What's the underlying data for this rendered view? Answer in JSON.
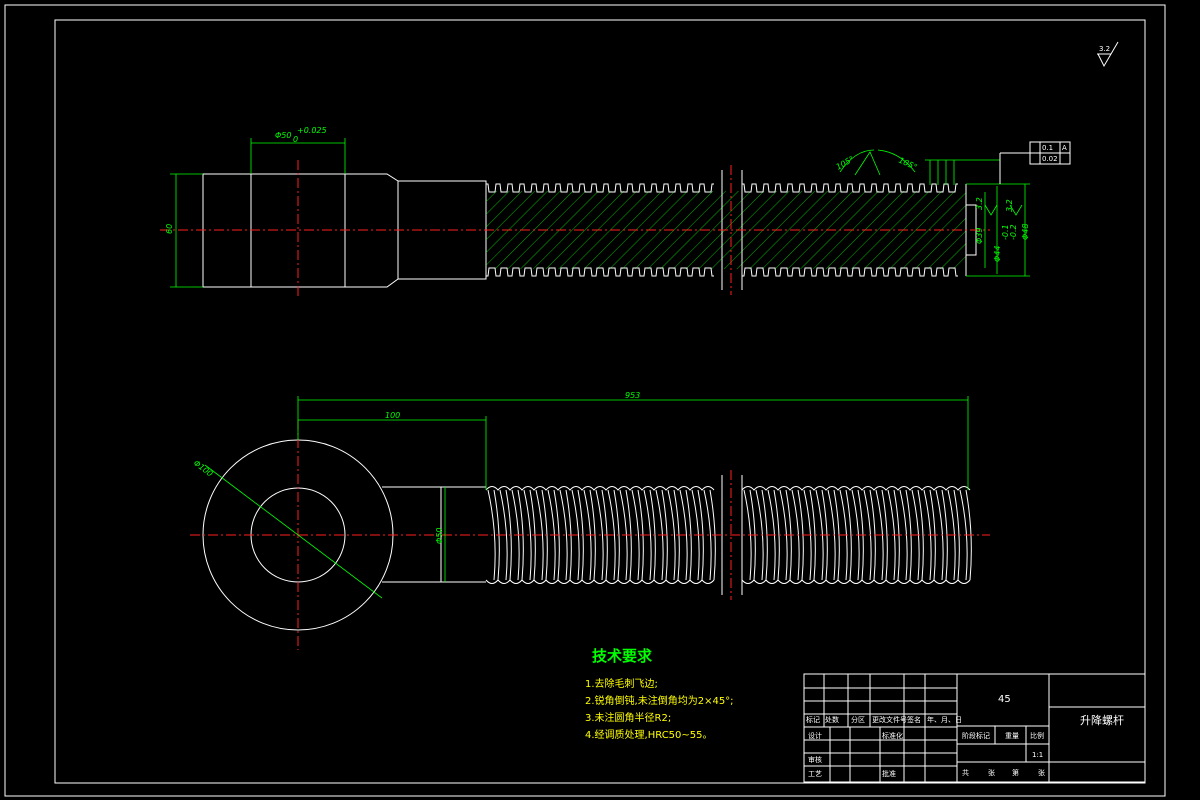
{
  "views": {
    "section": {
      "dim_bore": "Φ50",
      "dim_bore_tol": "+0.025",
      "dim_bore_tol_lower": "0",
      "dim_height": "60",
      "dim_d1": "Φ39",
      "dim_d2": "Φ44",
      "dim_d3": "Φ48",
      "dim_tol1": "-0.1",
      "dim_tol2": "-0.2",
      "thread_angle_1": "105°",
      "thread_angle_2": "105°",
      "roughness_1": "3.2",
      "roughness_2": "3.2",
      "geo_tol_1_value": "0.1",
      "geo_tol_1_datum": "A",
      "geo_tol_2_value": "0.02"
    },
    "front": {
      "dim_total": "953",
      "dim_neck": "100",
      "dim_eye_dia": "Φ100",
      "dim_shank": "Φ50"
    },
    "roughness_corner": "3.2"
  },
  "tech_requirements": {
    "title": "技术要求",
    "items": [
      "1.去除毛刺飞边;",
      "2.锐角倒钝,未注倒角均为2×45°;",
      "3.未注圆角半径R2;",
      "4.经调质处理,HRC50~55。"
    ]
  },
  "title_block": {
    "material": "45",
    "part_name": "升降螺杆",
    "scale": "1:1",
    "label_mark": "标记",
    "label_count": "处数",
    "label_zone": "分区",
    "label_doc": "更改文件号",
    "label_sign": "签名",
    "label_date": "年、月、日",
    "label_design": "设计",
    "label_standard": "标准化",
    "label_stage": "阶段标记",
    "label_weight": "重量",
    "label_ratio": "比例",
    "label_review": "审核",
    "label_process": "工艺",
    "label_approve": "批准",
    "label_total": "共",
    "label_sheet": "张",
    "label_no": "第",
    "label_sheet2": "张"
  }
}
